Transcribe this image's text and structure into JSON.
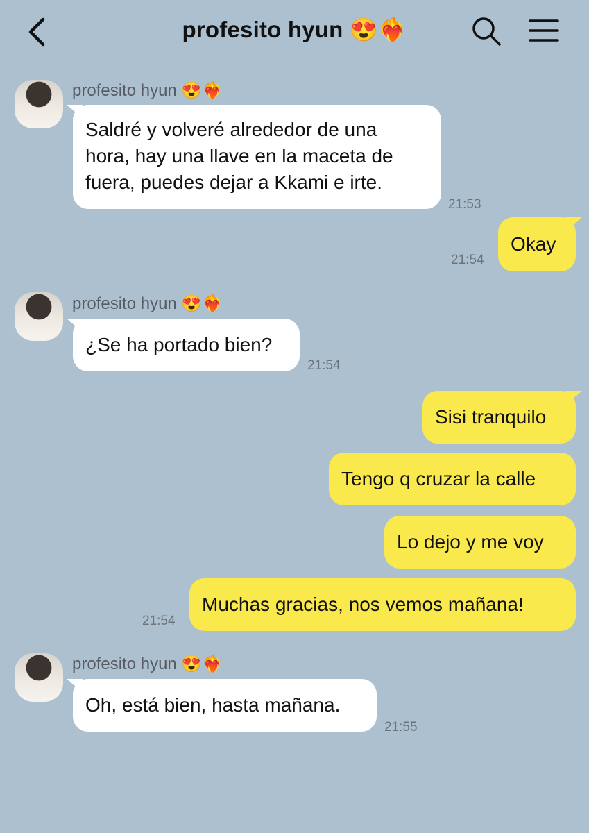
{
  "header": {
    "back_icon": "chevron-left-icon",
    "title": "profesito hyun 😍❤️‍🔥",
    "search_icon": "search-icon",
    "menu_icon": "hamburger-menu-icon"
  },
  "colors": {
    "background": "#adc0d0",
    "received_bubble": "#ffffff",
    "sent_bubble": "#f9e94c"
  },
  "messages": [
    {
      "sender": "profesito hyun 😍❤️‍🔥",
      "lines": [
        "Saldré y volveré alrededor de una",
        "hora, hay una llave en la maceta de",
        "fuera, puedes dejar a Kkami e irte."
      ],
      "time": "21:53"
    },
    {
      "text": "Okay",
      "time": "21:54"
    },
    {
      "sender": "profesito hyun 😍❤️‍🔥",
      "text": "¿Se ha portado bien?",
      "time": "21:54"
    },
    {
      "text": "Sisi tranquilo"
    },
    {
      "text": "Tengo q cruzar la calle"
    },
    {
      "text": "Lo dejo y me voy"
    },
    {
      "text": "Muchas gracias, nos vemos mañana!",
      "time": "21:54"
    },
    {
      "sender": "profesito hyun 😍❤️‍🔥",
      "text": "Oh, está bien, hasta mañana.",
      "time": "21:55"
    }
  ]
}
